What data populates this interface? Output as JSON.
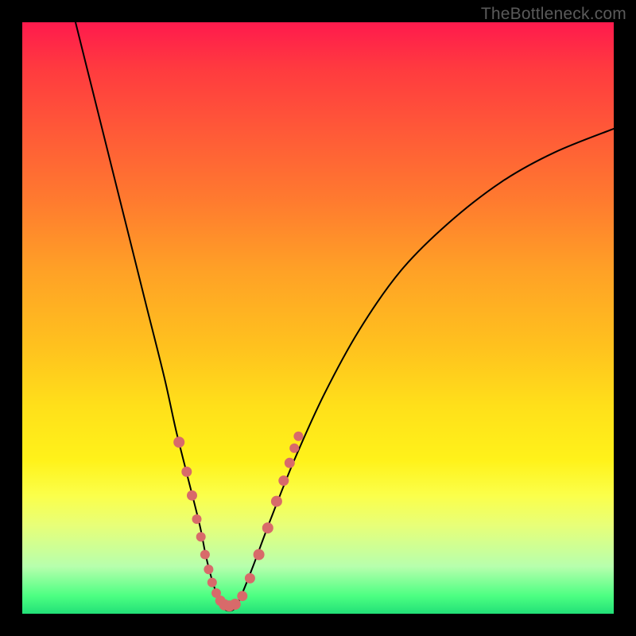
{
  "watermark": "TheBottleneck.com",
  "colors": {
    "frame_bg_top": "#ff1a4d",
    "frame_bg_bottom": "#22e077",
    "curve": "#000000",
    "marker": "#d86a6a",
    "page_bg": "#000000",
    "watermark": "#5a5a5a"
  },
  "chart_data": {
    "type": "line",
    "title": "",
    "xlabel": "",
    "ylabel": "",
    "xlim": [
      0,
      100
    ],
    "ylim": [
      0,
      100
    ],
    "grid": false,
    "legend": false,
    "series": [
      {
        "name": "bottleneck-curve",
        "x": [
          9,
          12,
          15,
          18,
          21,
          24,
          26,
          28,
          30,
          31,
          32,
          33,
          34,
          35,
          36,
          37,
          39,
          42,
          46,
          51,
          57,
          64,
          72,
          81,
          90,
          100
        ],
        "y": [
          100,
          88,
          76,
          64,
          52,
          40,
          31,
          23,
          15,
          10,
          6,
          3,
          1,
          0.5,
          1,
          3,
          8,
          16,
          26,
          37,
          48,
          58,
          66,
          73,
          78,
          82
        ]
      }
    ],
    "markers": {
      "name": "highlight-points",
      "x": [
        26.5,
        27.8,
        28.7,
        29.5,
        30.2,
        30.9,
        31.5,
        32.1,
        32.8,
        33.5,
        34.2,
        35.0,
        36.0,
        37.2,
        38.5,
        40.0,
        41.5,
        43.0,
        44.2,
        45.2,
        46.0,
        46.7
      ],
      "y": [
        29,
        24,
        20,
        16,
        13,
        10,
        7.5,
        5.3,
        3.5,
        2.2,
        1.5,
        1.3,
        1.6,
        3.0,
        6.0,
        10.0,
        14.5,
        19.0,
        22.5,
        25.5,
        28.0,
        30.0
      ],
      "r": [
        7,
        6.5,
        6.5,
        6,
        6,
        6,
        6,
        6,
        6,
        6.5,
        7,
        7,
        7,
        6.5,
        6.5,
        7,
        7,
        7,
        6.5,
        6.5,
        6,
        6
      ]
    }
  }
}
